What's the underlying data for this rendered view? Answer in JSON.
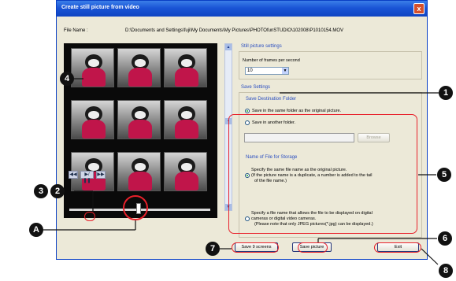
{
  "window": {
    "title": "Create still picture from video",
    "close_glyph": "x"
  },
  "file": {
    "label": "File Name :",
    "value": "D:\\Documents and Settings\\fuji\\My Documents\\My Pictures\\PHOTOfunSTUDIO\\102008\\P1010154.MOV"
  },
  "player": {
    "thumbnails_count": 9,
    "controls": [
      {
        "name": "rewind-button",
        "glyph": "◀◀"
      },
      {
        "name": "play-pause-button",
        "glyph": "▶/❚❚"
      },
      {
        "name": "fast-forward-button",
        "glyph": "▶▶"
      }
    ],
    "slider_position": 0.49
  },
  "still_settings": {
    "heading": "Still picture settings",
    "frames_label": "Number of frames per second",
    "frames_value": "10"
  },
  "save_settings": {
    "heading": "Save Settings",
    "destination": {
      "heading": "Save Destination Folder",
      "option_same": "Save in the same folder as the original picture.",
      "option_other": "Save in another folder.",
      "browse_label": "Browse"
    },
    "naming": {
      "heading": "Name of File for Storage",
      "option_same_line1": "Specify the same file name as the original picture.",
      "option_same_line2": "(If the picture name is a duplicate, a number is added to the tail",
      "option_same_line3": "of the file name.)",
      "option_digital_line1": "Specify a file name that allows the file to be displayed on digital",
      "option_digital_line2": "cameras or digital video cameras.",
      "option_digital_line3": "(Please note that only JPEG pictures(*.jpg) can be displayed.)"
    }
  },
  "buttons": {
    "save9": "Save 9 screens",
    "save_picture": "Save picture",
    "exit": "Exit"
  },
  "callouts": {
    "c1": "1",
    "c2": "2",
    "c3": "3",
    "c4": "4",
    "c5": "5",
    "c6": "6",
    "c7": "7",
    "c8": "8",
    "cA": "A"
  },
  "colors": {
    "title_bar": "#1a55d6",
    "annotation_red": "#e8202a",
    "section_heading": "#2a4ec0"
  }
}
